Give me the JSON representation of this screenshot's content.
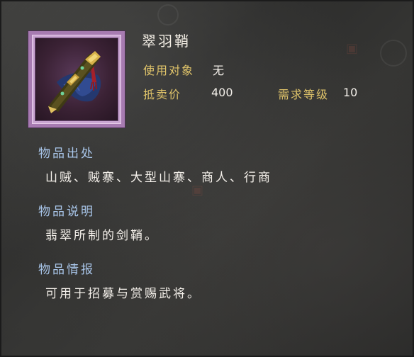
{
  "item": {
    "name": "翠羽鞘",
    "icon": "jade-sword-sheath-icon",
    "frame_color": "#a77bb1"
  },
  "attributes": {
    "target_label": "使用对象",
    "target_value": "无",
    "price_label": "抵卖价",
    "price_value": "400",
    "level_label": "需求等级",
    "level_value": "10"
  },
  "sections": {
    "origin": {
      "title": "物品出处",
      "text": "山贼、贼寨、大型山寨、商人、行商"
    },
    "description": {
      "title": "物品说明",
      "text": "翡翠所制的剑鞘。"
    },
    "info": {
      "title": "物品情报",
      "text": "可用于招募与赏赐武将。"
    }
  },
  "colors": {
    "label": "#e0c46a",
    "section_title": "#a9c6ea",
    "text": "#f4f0ea"
  }
}
